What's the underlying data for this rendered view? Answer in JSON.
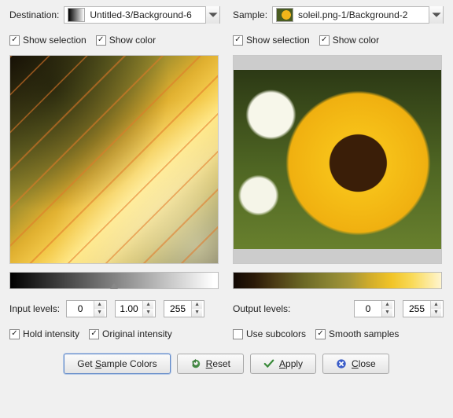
{
  "left": {
    "dropdownLabel": "Destination:",
    "dropdownValue": "Untitled-3/Background-6",
    "showSelection": "Show selection",
    "showColor": "Show color",
    "levelsLabel": "Input levels:",
    "level1": "0",
    "level2": "1.00",
    "level3": "255",
    "holdIntensity": "Hold intensity",
    "originalIntensity": "Original intensity"
  },
  "right": {
    "dropdownLabel": "Sample:",
    "dropdownValue": "soleil.png-1/Background-2",
    "showSelection": "Show selection",
    "showColor": "Show color",
    "levelsLabel": "Output levels:",
    "level1": "0",
    "level3": "255",
    "useSubcolors": "Use subcolors",
    "smoothSamples": "Smooth samples"
  },
  "buttons": {
    "getSample": "Get Sample Colors",
    "reset": "Reset",
    "apply": "Apply",
    "close": "Close"
  }
}
